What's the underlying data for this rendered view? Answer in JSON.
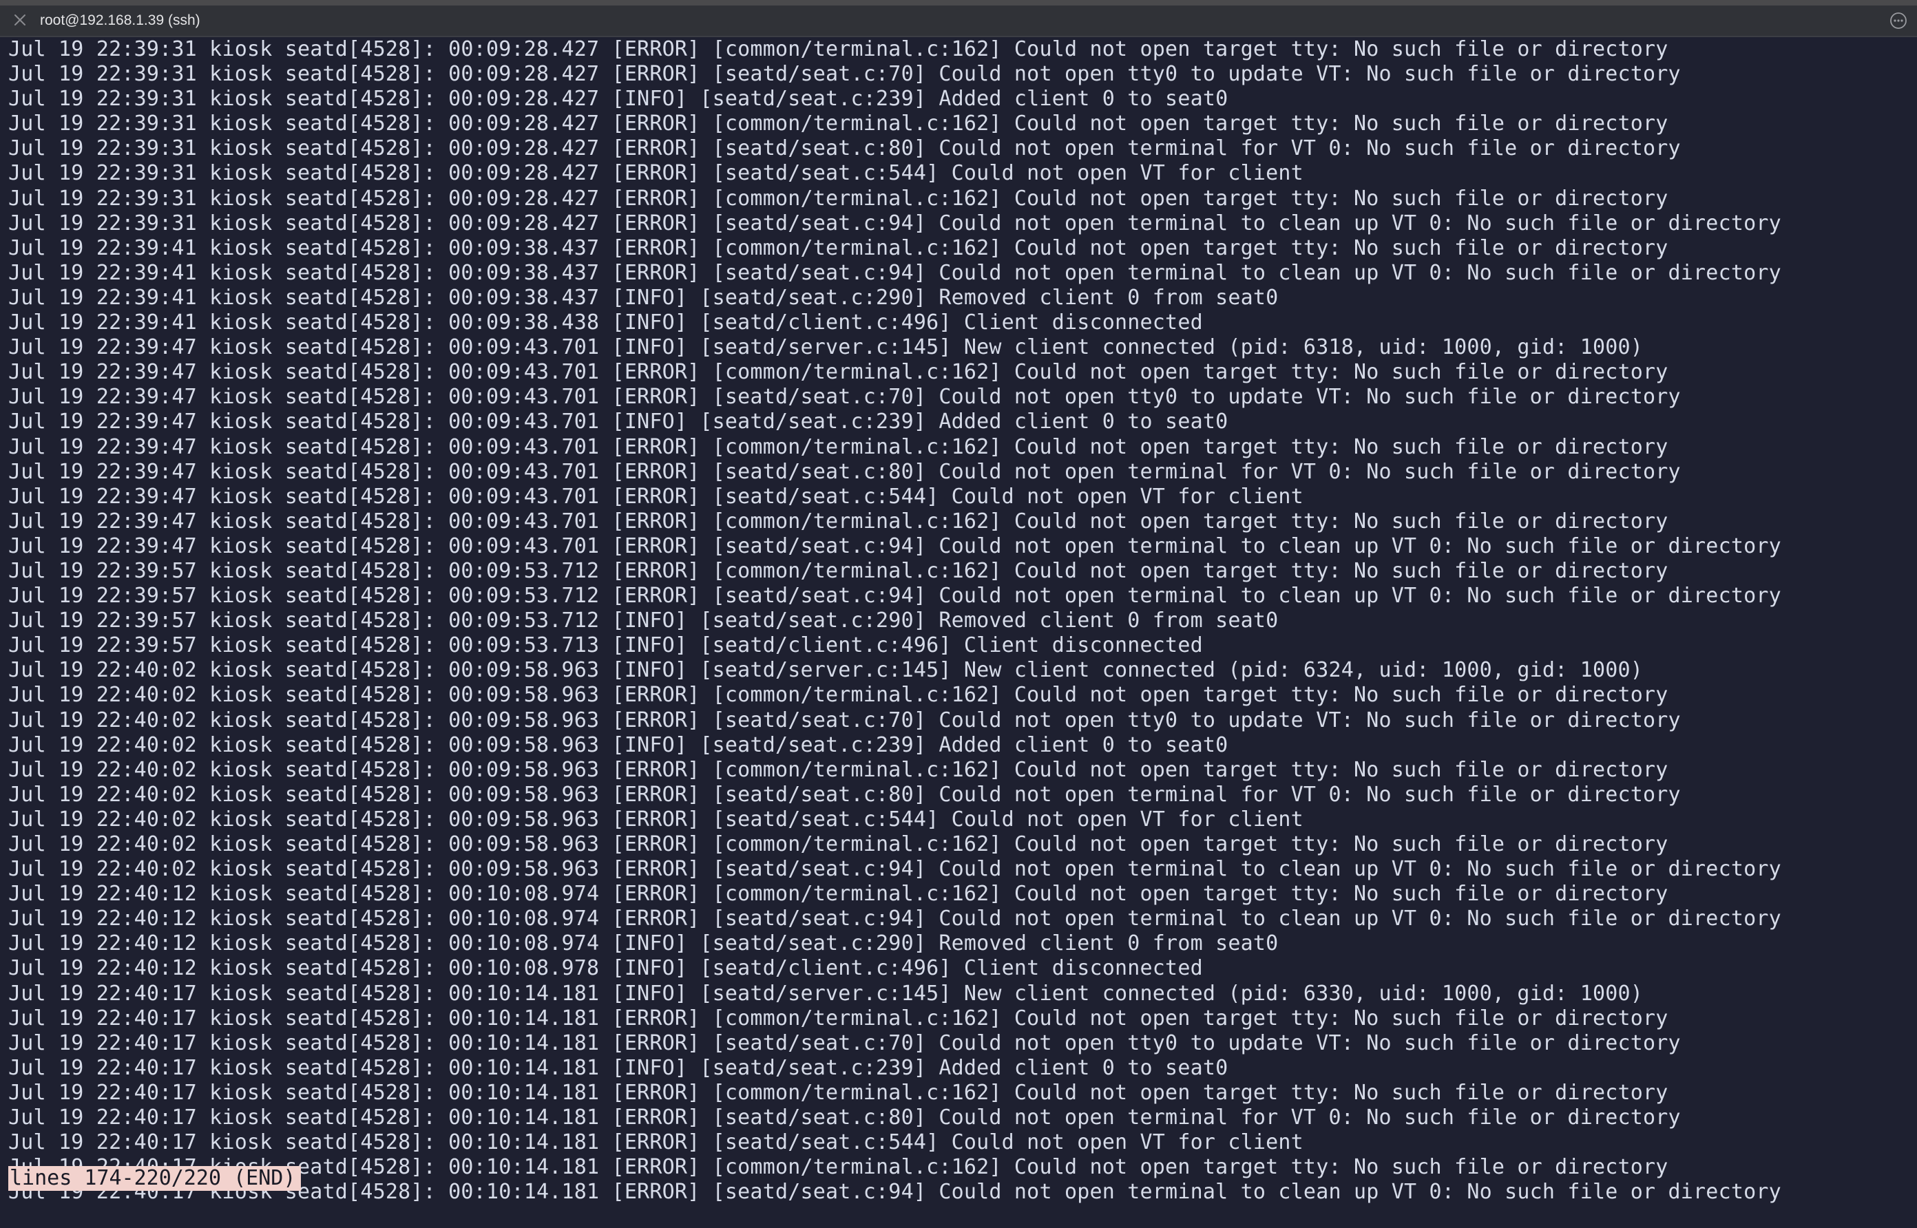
{
  "window": {
    "title": "root@192.168.1.39 (ssh)",
    "close_icon": "close-x-icon",
    "more_icon": "ellipsis-circle-icon"
  },
  "terminal": {
    "lines": [
      "Jul 19 22:39:31 kiosk seatd[4528]: 00:09:28.427 [ERROR] [common/terminal.c:162] Could not open target tty: No such file or directory",
      "Jul 19 22:39:31 kiosk seatd[4528]: 00:09:28.427 [ERROR] [seatd/seat.c:70] Could not open tty0 to update VT: No such file or directory",
      "Jul 19 22:39:31 kiosk seatd[4528]: 00:09:28.427 [INFO] [seatd/seat.c:239] Added client 0 to seat0",
      "Jul 19 22:39:31 kiosk seatd[4528]: 00:09:28.427 [ERROR] [common/terminal.c:162] Could not open target tty: No such file or directory",
      "Jul 19 22:39:31 kiosk seatd[4528]: 00:09:28.427 [ERROR] [seatd/seat.c:80] Could not open terminal for VT 0: No such file or directory",
      "Jul 19 22:39:31 kiosk seatd[4528]: 00:09:28.427 [ERROR] [seatd/seat.c:544] Could not open VT for client",
      "Jul 19 22:39:31 kiosk seatd[4528]: 00:09:28.427 [ERROR] [common/terminal.c:162] Could not open target tty: No such file or directory",
      "Jul 19 22:39:31 kiosk seatd[4528]: 00:09:28.427 [ERROR] [seatd/seat.c:94] Could not open terminal to clean up VT 0: No such file or directory",
      "Jul 19 22:39:41 kiosk seatd[4528]: 00:09:38.437 [ERROR] [common/terminal.c:162] Could not open target tty: No such file or directory",
      "Jul 19 22:39:41 kiosk seatd[4528]: 00:09:38.437 [ERROR] [seatd/seat.c:94] Could not open terminal to clean up VT 0: No such file or directory",
      "Jul 19 22:39:41 kiosk seatd[4528]: 00:09:38.437 [INFO] [seatd/seat.c:290] Removed client 0 from seat0",
      "Jul 19 22:39:41 kiosk seatd[4528]: 00:09:38.438 [INFO] [seatd/client.c:496] Client disconnected",
      "Jul 19 22:39:47 kiosk seatd[4528]: 00:09:43.701 [INFO] [seatd/server.c:145] New client connected (pid: 6318, uid: 1000, gid: 1000)",
      "Jul 19 22:39:47 kiosk seatd[4528]: 00:09:43.701 [ERROR] [common/terminal.c:162] Could not open target tty: No such file or directory",
      "Jul 19 22:39:47 kiosk seatd[4528]: 00:09:43.701 [ERROR] [seatd/seat.c:70] Could not open tty0 to update VT: No such file or directory",
      "Jul 19 22:39:47 kiosk seatd[4528]: 00:09:43.701 [INFO] [seatd/seat.c:239] Added client 0 to seat0",
      "Jul 19 22:39:47 kiosk seatd[4528]: 00:09:43.701 [ERROR] [common/terminal.c:162] Could not open target tty: No such file or directory",
      "Jul 19 22:39:47 kiosk seatd[4528]: 00:09:43.701 [ERROR] [seatd/seat.c:80] Could not open terminal for VT 0: No such file or directory",
      "Jul 19 22:39:47 kiosk seatd[4528]: 00:09:43.701 [ERROR] [seatd/seat.c:544] Could not open VT for client",
      "Jul 19 22:39:47 kiosk seatd[4528]: 00:09:43.701 [ERROR] [common/terminal.c:162] Could not open target tty: No such file or directory",
      "Jul 19 22:39:47 kiosk seatd[4528]: 00:09:43.701 [ERROR] [seatd/seat.c:94] Could not open terminal to clean up VT 0: No such file or directory",
      "Jul 19 22:39:57 kiosk seatd[4528]: 00:09:53.712 [ERROR] [common/terminal.c:162] Could not open target tty: No such file or directory",
      "Jul 19 22:39:57 kiosk seatd[4528]: 00:09:53.712 [ERROR] [seatd/seat.c:94] Could not open terminal to clean up VT 0: No such file or directory",
      "Jul 19 22:39:57 kiosk seatd[4528]: 00:09:53.712 [INFO] [seatd/seat.c:290] Removed client 0 from seat0",
      "Jul 19 22:39:57 kiosk seatd[4528]: 00:09:53.713 [INFO] [seatd/client.c:496] Client disconnected",
      "Jul 19 22:40:02 kiosk seatd[4528]: 00:09:58.963 [INFO] [seatd/server.c:145] New client connected (pid: 6324, uid: 1000, gid: 1000)",
      "Jul 19 22:40:02 kiosk seatd[4528]: 00:09:58.963 [ERROR] [common/terminal.c:162] Could not open target tty: No such file or directory",
      "Jul 19 22:40:02 kiosk seatd[4528]: 00:09:58.963 [ERROR] [seatd/seat.c:70] Could not open tty0 to update VT: No such file or directory",
      "Jul 19 22:40:02 kiosk seatd[4528]: 00:09:58.963 [INFO] [seatd/seat.c:239] Added client 0 to seat0",
      "Jul 19 22:40:02 kiosk seatd[4528]: 00:09:58.963 [ERROR] [common/terminal.c:162] Could not open target tty: No such file or directory",
      "Jul 19 22:40:02 kiosk seatd[4528]: 00:09:58.963 [ERROR] [seatd/seat.c:80] Could not open terminal for VT 0: No such file or directory",
      "Jul 19 22:40:02 kiosk seatd[4528]: 00:09:58.963 [ERROR] [seatd/seat.c:544] Could not open VT for client",
      "Jul 19 22:40:02 kiosk seatd[4528]: 00:09:58.963 [ERROR] [common/terminal.c:162] Could not open target tty: No such file or directory",
      "Jul 19 22:40:02 kiosk seatd[4528]: 00:09:58.963 [ERROR] [seatd/seat.c:94] Could not open terminal to clean up VT 0: No such file or directory",
      "Jul 19 22:40:12 kiosk seatd[4528]: 00:10:08.974 [ERROR] [common/terminal.c:162] Could not open target tty: No such file or directory",
      "Jul 19 22:40:12 kiosk seatd[4528]: 00:10:08.974 [ERROR] [seatd/seat.c:94] Could not open terminal to clean up VT 0: No such file or directory",
      "Jul 19 22:40:12 kiosk seatd[4528]: 00:10:08.974 [INFO] [seatd/seat.c:290] Removed client 0 from seat0",
      "Jul 19 22:40:12 kiosk seatd[4528]: 00:10:08.978 [INFO] [seatd/client.c:496] Client disconnected",
      "Jul 19 22:40:17 kiosk seatd[4528]: 00:10:14.181 [INFO] [seatd/server.c:145] New client connected (pid: 6330, uid: 1000, gid: 1000)",
      "Jul 19 22:40:17 kiosk seatd[4528]: 00:10:14.181 [ERROR] [common/terminal.c:162] Could not open target tty: No such file or directory",
      "Jul 19 22:40:17 kiosk seatd[4528]: 00:10:14.181 [ERROR] [seatd/seat.c:70] Could not open tty0 to update VT: No such file or directory",
      "Jul 19 22:40:17 kiosk seatd[4528]: 00:10:14.181 [INFO] [seatd/seat.c:239] Added client 0 to seat0",
      "Jul 19 22:40:17 kiosk seatd[4528]: 00:10:14.181 [ERROR] [common/terminal.c:162] Could not open target tty: No such file or directory",
      "Jul 19 22:40:17 kiosk seatd[4528]: 00:10:14.181 [ERROR] [seatd/seat.c:80] Could not open terminal for VT 0: No such file or directory",
      "Jul 19 22:40:17 kiosk seatd[4528]: 00:10:14.181 [ERROR] [seatd/seat.c:544] Could not open VT for client",
      "Jul 19 22:40:17 kiosk seatd[4528]: 00:10:14.181 [ERROR] [common/terminal.c:162] Could not open target tty: No such file or directory",
      "Jul 19 22:40:17 kiosk seatd[4528]: 00:10:14.181 [ERROR] [seatd/seat.c:94] Could not open terminal to clean up VT 0: No such file or directory"
    ],
    "status": "lines 174-220/220 (END)"
  },
  "colors": {
    "background": "#1e2030",
    "text": "#d6dbe8",
    "titlebar": "#303237",
    "status_bg": "#f2d2cd",
    "status_fg": "#1a1b26"
  }
}
